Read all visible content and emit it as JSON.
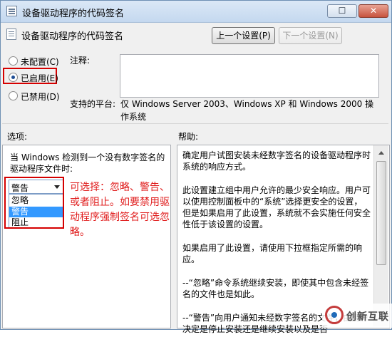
{
  "window": {
    "title": "设备驱动程序的代码签名",
    "maximize_glyph": "☐",
    "close_glyph": "✕"
  },
  "header": {
    "title": "设备驱动程序的代码签名",
    "prev_button": "上一个设置(P)",
    "next_button": "下一个设置(N)"
  },
  "state": {
    "options": [
      {
        "label": "未配置(C)",
        "selected": false
      },
      {
        "label": "已启用(E)",
        "selected": true
      },
      {
        "label": "已禁用(D)",
        "selected": false
      }
    ]
  },
  "fields": {
    "comment_label": "注释:",
    "comment_value": "",
    "platform_label": "支持的平台:",
    "platform_value": "仅 Windows Server 2003、Windows XP 和 Windows 2000 操作系统"
  },
  "options_section": {
    "label": "选项:",
    "description": "当 Windows 检测到一个没有数字签名的驱动程序文件时:",
    "dropdown_value": "警告",
    "dropdown_items": [
      "忽略",
      "警告",
      "阻止"
    ],
    "selected_index": 1
  },
  "annotation": {
    "text": "可选择：忽略、警告、或者阻止。如要禁用驱动程序强制签名可选忽略。",
    "color": "#e01d1d"
  },
  "help_section": {
    "label": "帮助:",
    "paragraphs": [
      "确定用户试图安装未经数字签名的设备驱动程序时系统的响应方式。",
      "此设置建立组中用户允许的最少安全响应。用户可以使用控制面板中的“系统”选择更安全的设置，但是如果启用了此设置，系统就不会实施任何安全性低于该设置的设置。",
      "如果启用了此设置，请使用下拉框指定所需的响应。",
      "--“忽略”命令系统继续安装，即使其中包含未经签名的文件也是如此。",
      "--“警告”向用户通知未经数字签名的文件，由用户决定是停止安装还是继续安装以及是否"
    ]
  },
  "watermark": {
    "text": "创新互联"
  }
}
